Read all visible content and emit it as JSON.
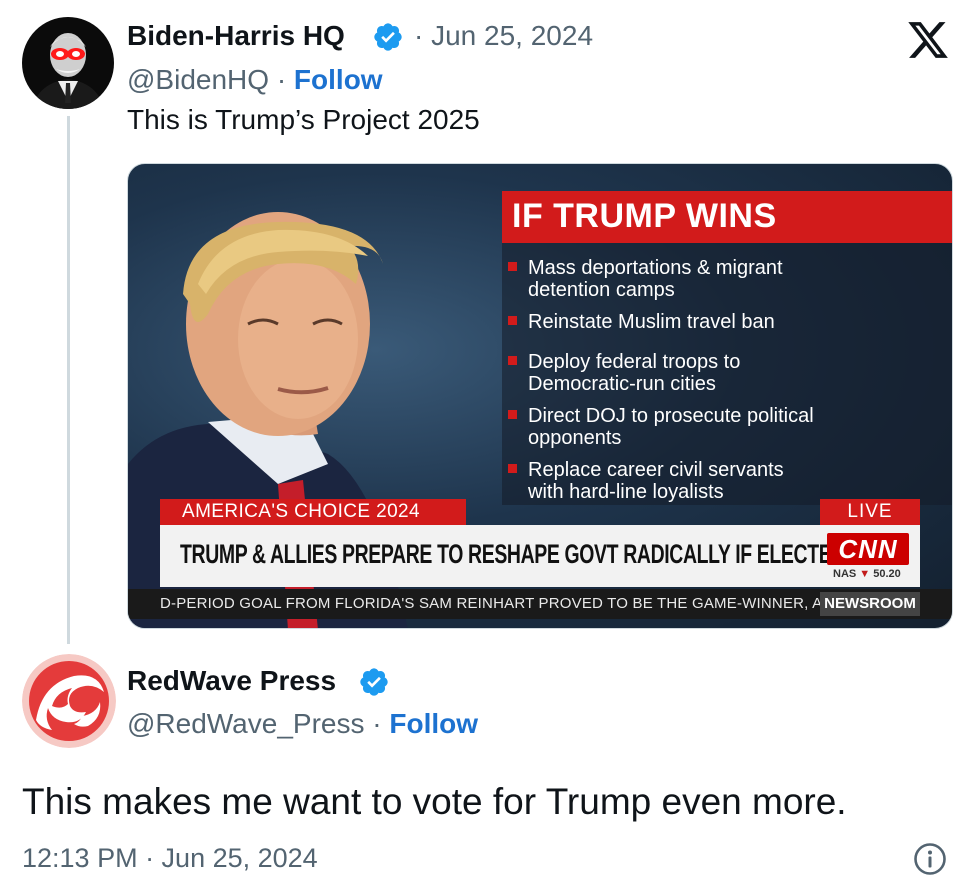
{
  "tweet1": {
    "display_name": "Biden-Harris HQ",
    "date": "· Jun 25, 2024",
    "handle": "@BidenHQ ·",
    "follow_label": "Follow",
    "text": "This is Trump’s Project 2025"
  },
  "media": {
    "panel_title": "IF TRUMP WINS",
    "bullets": [
      [
        "Mass deportations & migrant",
        "detention camps"
      ],
      [
        "Reinstate Muslim travel ban"
      ],
      [
        "Deploy federal troops to",
        "Democratic-run cities"
      ],
      [
        "Direct DOJ to prosecute political",
        "opponents"
      ],
      [
        "Replace career civil servants",
        "with hard-line loyalists"
      ]
    ],
    "bullet_lines": {
      "b0a": "Mass deportations & migrant",
      "b0b": "detention camps",
      "b1a": "Reinstate Muslim travel ban",
      "b2a": "Deploy federal troops to",
      "b2b": "Democratic-run cities",
      "b3a": "Direct DOJ to prosecute political",
      "b3b": "opponents",
      "b4a": "Replace career civil servants",
      "b4b": "with hard-line loyalists"
    },
    "choice_label": "AMERICA'S CHOICE 2024",
    "live_label": "LIVE",
    "headline": "TRUMP & ALLIES PREPARE TO RESHAPE GOVT RADICALLY IF ELECTED",
    "network_logo": "CNN",
    "nas_label": "NAS",
    "nas_arrow": "▼",
    "nas_value": "50.20",
    "ticker_text": "D-PERIOD GOAL FROM FLORIDA'S SAM REINHART PROVED TO BE THE GAME-WINNER, AS",
    "ticker_tag": "NEWSROOM"
  },
  "tweet2": {
    "display_name": "RedWave Press",
    "handle": "@RedWave_Press ·",
    "follow_label": "Follow",
    "text": "This makes me want to vote for Trump even more.",
    "timestamp": "12:13 PM · Jun 25, 2024"
  },
  "colors": {
    "verified_blue": "#1d9bf0",
    "follow_blue": "#1d72d0",
    "news_red": "#d21b1b",
    "text_gray": "#536471"
  },
  "icons": {
    "verified": "verified-badge-icon",
    "platform": "x-logo-icon",
    "info": "info-icon"
  }
}
